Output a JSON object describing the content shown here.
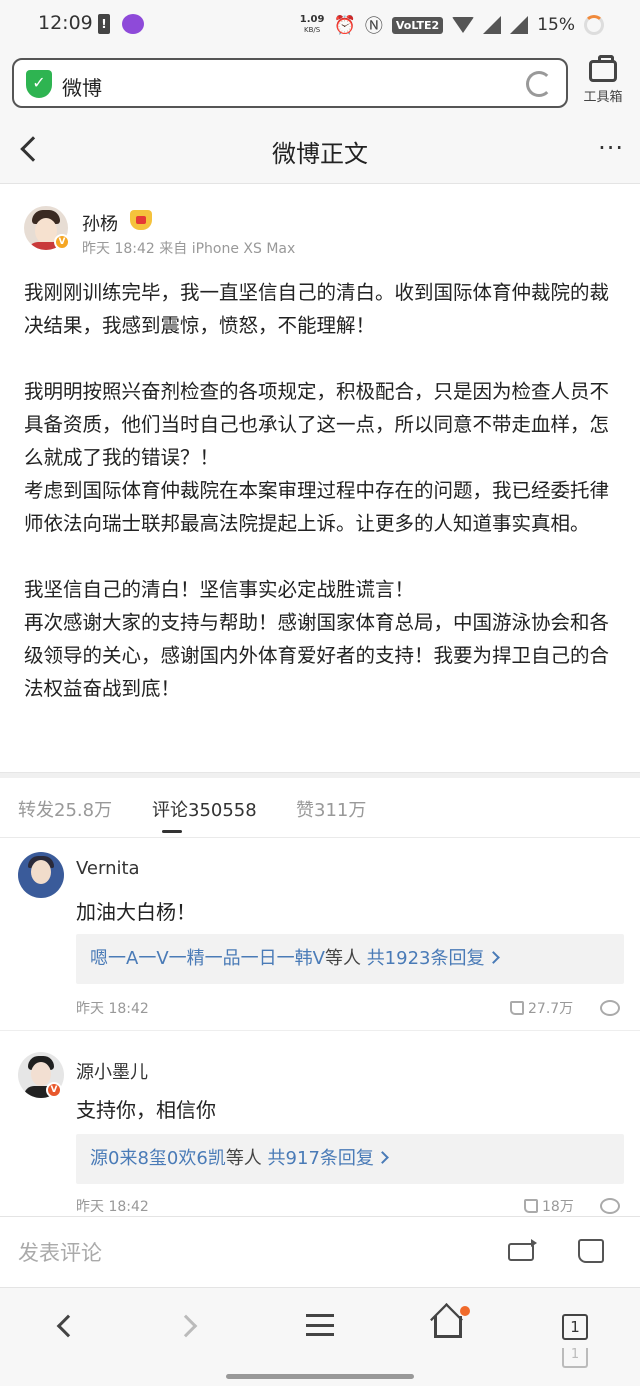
{
  "status_bar": {
    "time": "12:09",
    "net_speed": "1.09",
    "net_unit": "KB/S",
    "volte": "VoLTE2",
    "battery": "15%"
  },
  "url_bar": {
    "site": "微博",
    "toolbox_label": "工具箱"
  },
  "header": {
    "title": "微博正文",
    "more": "···"
  },
  "post": {
    "author": "孙杨",
    "meta": "昨天 18:42  来自 iPhone XS Max",
    "paragraphs": [
      "我刚刚训练完毕，我一直坚信自己的清白。收到国际体育仲裁院的裁决结果，我感到震惊，愤怒，不能理解！",
      "我明明按照兴奋剂检查的各项规定，积极配合，只是因为检查人员不具备资质，他们当时自己也承认了这一点，所以同意不带走血样，怎么就成了我的错误？！",
      "考虑到国际体育仲裁院在本案审理过程中存在的问题，我已经委托律师依法向瑞士联邦最高法院提起上诉。让更多的人知道事实真相。",
      "我坚信自己的清白！坚信事实必定战胜谎言！",
      "再次感谢大家的支持与帮助！感谢国家体育总局，中国游泳协会和各级领导的关心，感谢国内外体育爱好者的支持！我要为捍卫自己的合法权益奋战到底！"
    ]
  },
  "tabs": {
    "repost": "转发25.8万",
    "comments": "评论350558",
    "likes": "赞311万"
  },
  "comments": [
    {
      "name": "Vernita",
      "text": "加油大白杨！",
      "reply_users": "嗯一A一V一精一品一日一韩V",
      "reply_mid": "等人",
      "reply_count": "共1923条回复",
      "time": "昨天 18:42",
      "likes": "27.7万"
    },
    {
      "name": "源小墨儿",
      "text": "支持你，相信你",
      "reply_users": "源0来8玺0欢6凯",
      "reply_mid": "等人",
      "reply_count": "共917条回复",
      "time": "昨天 18:42",
      "likes": "18万"
    }
  ],
  "input_bar": {
    "placeholder": "发表评论"
  },
  "nav": {
    "tab_count": "1",
    "tab_count_ghost": "1"
  }
}
